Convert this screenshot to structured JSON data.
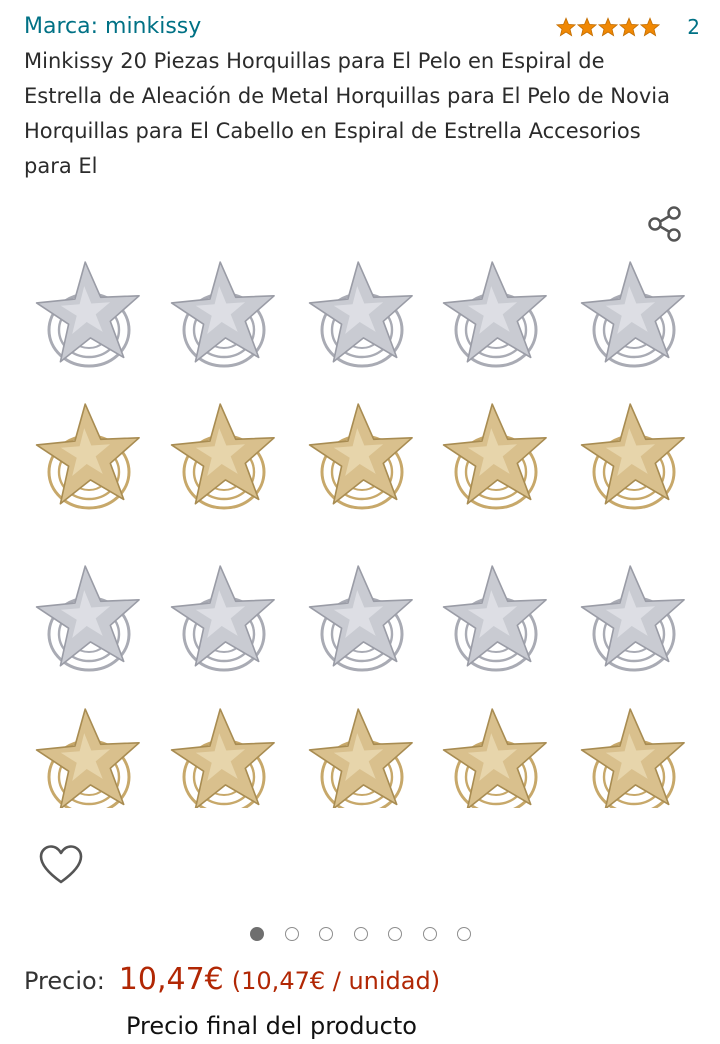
{
  "brand": {
    "label": "Marca: minkissy"
  },
  "rating": {
    "stars": 5,
    "count": "2",
    "star_color": "#F08804"
  },
  "product": {
    "title": "Minkissy 20 Piezas Horquillas para El Pelo en Espiral de Estrella de Aleación de Metal Horquillas para El Pelo de Novia Horquillas para El Cabello en Espiral de Estrella Accesorios para El"
  },
  "actions": {
    "share_icon": "share-icon",
    "wishlist_icon": "heart-outline-icon"
  },
  "gallery": {
    "total_images": 7,
    "active_index": 0
  },
  "image_content": {
    "rows": [
      "silver",
      "gold",
      "silver",
      "gold"
    ],
    "per_row": 5,
    "colors": {
      "silver": "#c9cbd2",
      "gold": "#d9c08d"
    }
  },
  "price": {
    "label": "Precio:",
    "value": "10,47€",
    "unit": "(10,47€ / unidad)",
    "note": "Precio final del producto",
    "color": "#B12704"
  },
  "colors": {
    "link": "#007185"
  }
}
